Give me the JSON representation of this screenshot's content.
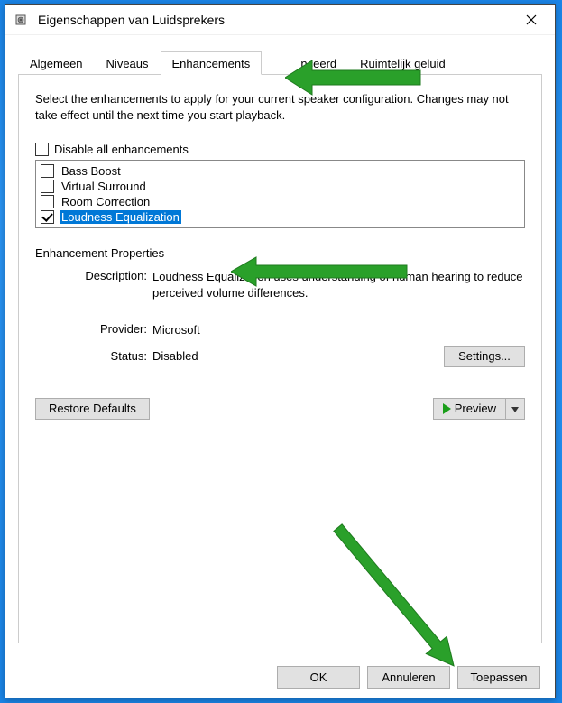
{
  "window": {
    "title": "Eigenschappen van Luidsprekers"
  },
  "tabs": {
    "general": "Algemeen",
    "levels": "Niveaus",
    "enhancements": "Enhancements",
    "advanced": "Geavanceerd",
    "spatial": "Ruimtelijk geluid",
    "active": "enhancements"
  },
  "panel": {
    "intro": "Select the enhancements to apply for your current speaker configuration. Changes may not take effect until the next time you start playback.",
    "disable_all_label": "Disable all enhancements",
    "disable_all_checked": false,
    "items": [
      {
        "label": "Bass Boost",
        "checked": false,
        "selected": false
      },
      {
        "label": "Virtual Surround",
        "checked": false,
        "selected": false
      },
      {
        "label": "Room Correction",
        "checked": false,
        "selected": false
      },
      {
        "label": "Loudness Equalization",
        "checked": true,
        "selected": true
      }
    ],
    "props_title": "Enhancement Properties",
    "desc_label": "Description:",
    "desc_value": "Loudness Equalization uses understanding of human hearing to reduce perceived volume differences.",
    "provider_label": "Provider:",
    "provider_value": "Microsoft",
    "status_label": "Status:",
    "status_value": "Disabled",
    "settings_btn": "Settings...",
    "restore_btn": "Restore Defaults",
    "preview_btn": "Preview"
  },
  "buttons": {
    "ok": "OK",
    "cancel": "Annuleren",
    "apply": "Toepassen"
  }
}
